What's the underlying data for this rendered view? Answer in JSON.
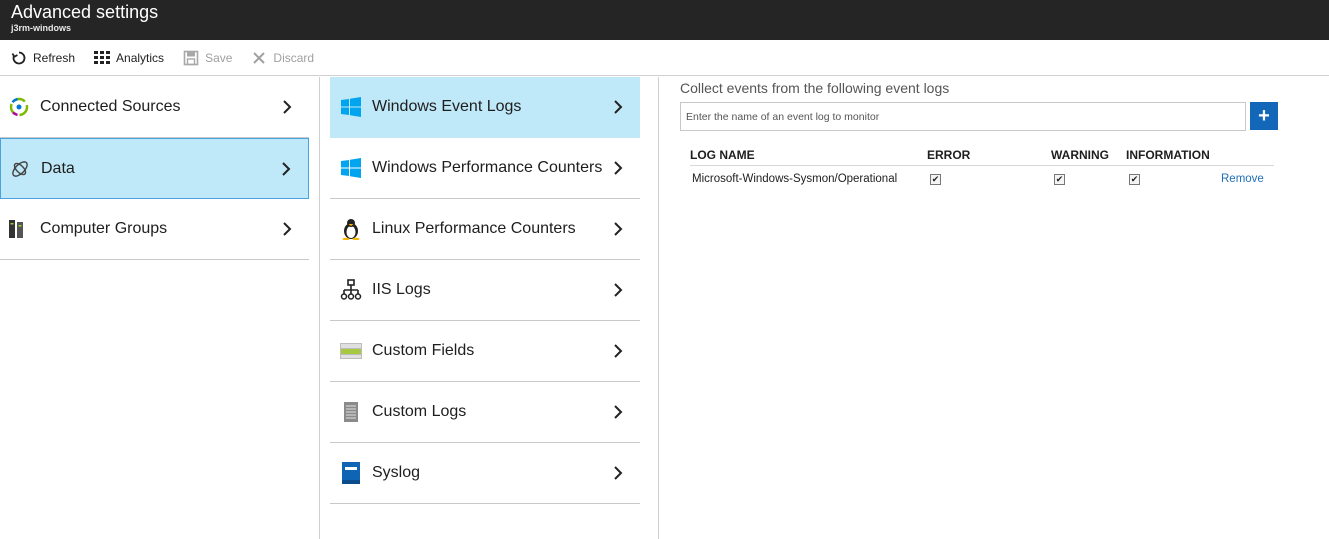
{
  "window": {
    "title": "Advanced settings",
    "subtitle": "j3rm-windows"
  },
  "toolbar": {
    "refresh": "Refresh",
    "analytics": "Analytics",
    "save": "Save",
    "discard": "Discard"
  },
  "col1": {
    "items": [
      {
        "label": "Connected Sources",
        "icon": "connected-sources-icon"
      },
      {
        "label": "Data",
        "icon": "data-icon",
        "selected": true
      },
      {
        "label": "Computer Groups",
        "icon": "computer-groups-icon"
      }
    ]
  },
  "col2": {
    "items": [
      {
        "label": "Windows Event Logs",
        "icon": "windows-icon",
        "selected": true
      },
      {
        "label": "Windows Performance Counters",
        "icon": "windows-icon"
      },
      {
        "label": "Linux Performance Counters",
        "icon": "linux-icon"
      },
      {
        "label": "IIS Logs",
        "icon": "network-icon"
      },
      {
        "label": "Custom Fields",
        "icon": "custom-fields-icon"
      },
      {
        "label": "Custom Logs",
        "icon": "custom-logs-icon"
      },
      {
        "label": "Syslog",
        "icon": "syslog-icon"
      }
    ]
  },
  "detail": {
    "title": "Collect events from the following event logs",
    "input_placeholder": "Enter the name of an event log to monitor",
    "add_label": "+",
    "columns": [
      "LOG NAME",
      "ERROR",
      "WARNING",
      "INFORMATION"
    ],
    "rows": [
      {
        "log_name": "Microsoft-Windows-Sysmon/Operational",
        "error": true,
        "warning": true,
        "information": true,
        "remove": "Remove"
      }
    ]
  },
  "colors": {
    "accent": "#1367b8",
    "selected_bg": "#bfe9f9",
    "titlebar": "#252525"
  }
}
